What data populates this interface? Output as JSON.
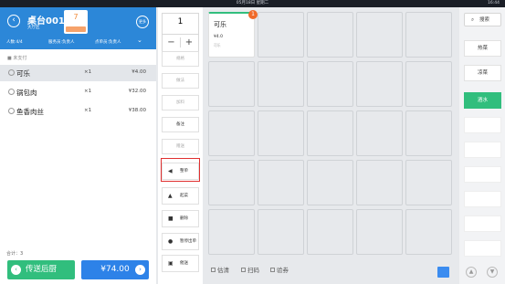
{
  "status": {
    "datetime": "05月18日 星期二",
    "time": "16:44"
  },
  "table": {
    "name": "桌台001",
    "area": "大厅区",
    "guest_count": "7",
    "more": "更多"
  },
  "info": {
    "people": "人数:4/4",
    "server": "服务员:负责人",
    "orderer": "点单员:负责人",
    "chevron": "⌄"
  },
  "order": {
    "section": "未支付",
    "items": [
      {
        "name": "可乐",
        "qty": "×1",
        "price": "¥4.00"
      },
      {
        "name": "锅包肉",
        "qty": "×1",
        "price": "¥32.00"
      },
      {
        "name": "鱼香肉丝",
        "qty": "×1",
        "price": "¥38.00"
      }
    ],
    "total_count": "合计：3"
  },
  "send_label": "传送后厨",
  "pay_label": "¥74.00",
  "qty": {
    "value": "1",
    "minus": "−",
    "plus": "+"
  },
  "actions": {
    "a1": "规格",
    "a2": "做法",
    "a3": "加料",
    "a4": "备注",
    "a5": "赠送",
    "b1": "整单",
    "b2": "起菜",
    "b3": "删除",
    "b4": "暂停出单",
    "b5": "催送"
  },
  "dish": {
    "name": "可乐",
    "price": "¥4.0",
    "sub": "可乐",
    "badge": "1"
  },
  "bottom": {
    "estimate": "估清",
    "scan": "扫码",
    "coupon": "验券"
  },
  "search": {
    "label": "搜索"
  },
  "categories": [
    "热菜",
    "凉菜",
    "酒水"
  ],
  "colors": {
    "brand_blue": "#2c87d8",
    "green": "#31be7d",
    "orange": "#f06a2a"
  }
}
